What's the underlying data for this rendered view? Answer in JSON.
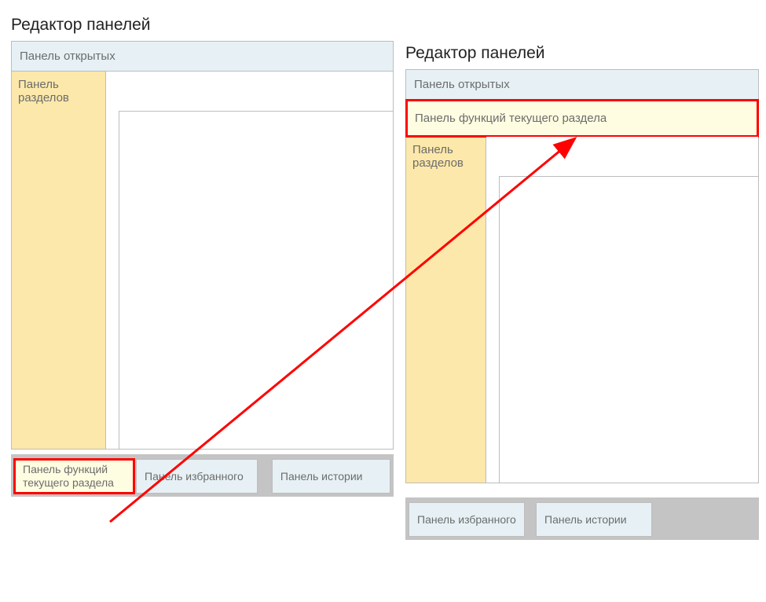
{
  "left": {
    "title": "Редактор панелей",
    "open_panel": "Панель открытых",
    "sections_panel": "Панель разделов",
    "tray": {
      "functions": "Панель функций текущего раздела",
      "favorites": "Панель избранного",
      "history": "Панель истории"
    }
  },
  "right": {
    "title": "Редактор панелей",
    "open_panel": "Панель открытых",
    "functions_panel": "Панель функций текущего раздела",
    "sections_panel": "Панель разделов",
    "tray": {
      "favorites": "Панель избранного",
      "history": "Панель истории"
    }
  }
}
